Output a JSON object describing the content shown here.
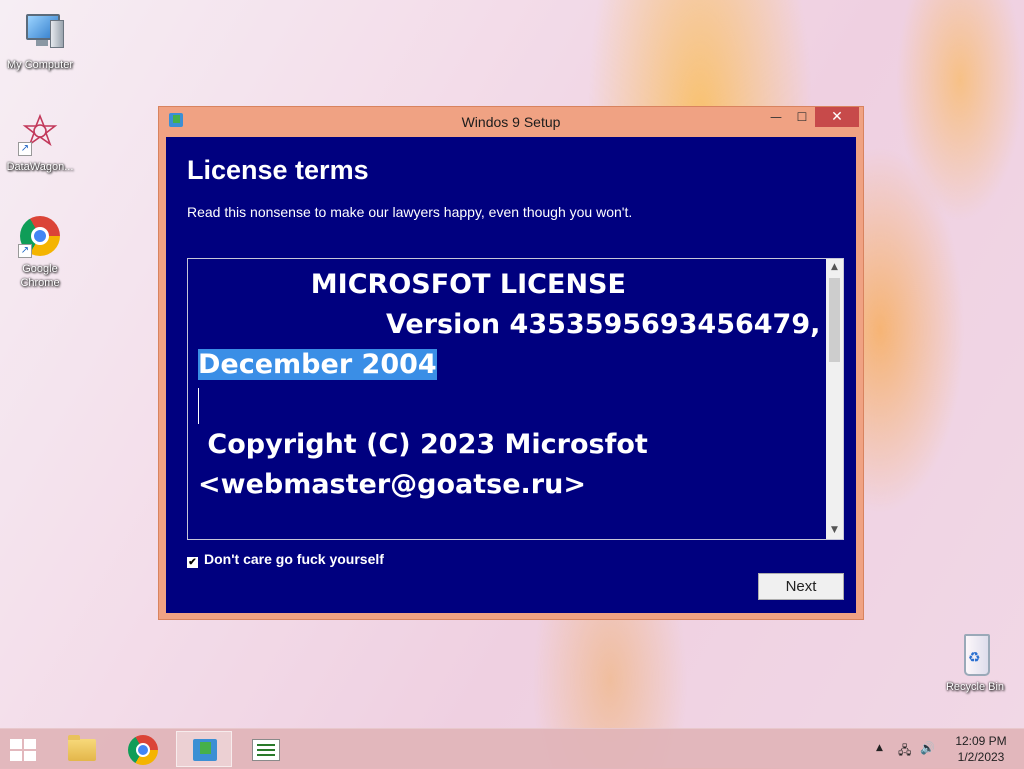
{
  "desktop": {
    "icons": [
      {
        "label": "My Computer",
        "icon": "computer-icon"
      },
      {
        "label": "DataWagon...",
        "icon": "datawagon-icon"
      },
      {
        "label": "Google Chrome",
        "icon": "chrome-icon"
      },
      {
        "label": "Recycle Bin",
        "icon": "recycle-bin-icon"
      }
    ]
  },
  "window": {
    "title": "Windos 9 Setup",
    "controls": {
      "minimize": "—",
      "maximize": "☐",
      "close": "✕"
    },
    "heading": "License terms",
    "subheading": "Read this nonsense to make our lawyers happy, even though you won't.",
    "license": {
      "line1": "            MICROSFOT LICENSE",
      "line2_pre": "                    Version 4353595693456479,",
      "line3_selected": "December 2004",
      "line5": " Copyright (C) 2023 Microsfot",
      "line6": "<webmaster@goatse.ru>"
    },
    "checkbox": {
      "label": "Don't care go fuck yourself",
      "checked": true,
      "mark": "✔"
    },
    "next_label": "Next"
  },
  "taskbar": {
    "items": [
      {
        "icon": "start-icon"
      },
      {
        "icon": "file-explorer-icon"
      },
      {
        "icon": "chrome-icon"
      },
      {
        "icon": "setup-icon",
        "active": true
      },
      {
        "icon": "task-list-icon"
      }
    ],
    "tray": {
      "chevron": "▲",
      "network": "🖧",
      "volume": "🔊"
    },
    "clock": {
      "time": "12:09 PM",
      "date": "1/2/2023"
    }
  },
  "colors": {
    "setup_background": "#00007f",
    "window_frame": "#f0a283",
    "close_button": "#c74a4a",
    "selection": "#3a8ee6"
  }
}
